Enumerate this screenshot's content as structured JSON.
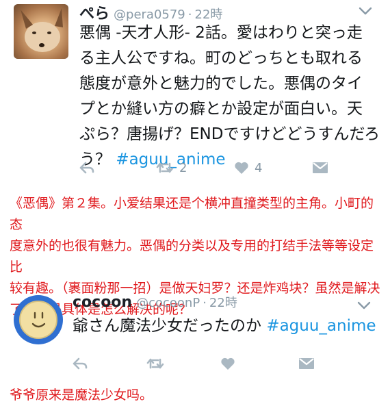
{
  "tweet1": {
    "name": "ぺら",
    "handle": "@pera0579",
    "dot": "·",
    "time": "22時",
    "lines": [
      "悪偶 -天才人形- 2話。愛はわりと突っ走",
      "る主人公ですね。町のどっちとも取れる",
      "態度が意外と魅力的でした。悪偶のタイ",
      "プとか縫い方の癖とか設定が面白い。天",
      "ぷら？唐揚げ？ENDですけどどうすんだろ",
      "う？"
    ],
    "hashtag": "#aguu_anime",
    "retweets": "2",
    "likes": "4"
  },
  "translation1": {
    "lines": [
      "《恶偶》第２集。小爱结果还是个横冲直撞类型的主角。小町的态",
      "度意外的也很有魅力。恶偶的分类以及专用的打结手法等等设定比",
      "较有趣。（裹面粉那一招）是做天妇罗？还是炸鸡块？虽然是解决",
      "了他但是具体是怎么解决的呢？"
    ]
  },
  "tweet2": {
    "name": "cocoon",
    "handle": "@cocoonP",
    "dot": "·",
    "time": "22時",
    "text": "爺さん魔法少女だったのか",
    "hashtag": "#aguu_anime"
  },
  "translation2": {
    "text": "爷爷原来是魔法少女吗。"
  },
  "icons": {
    "reply": "reply-icon",
    "retweet": "retweet-icon",
    "like": "heart-icon",
    "dm": "direct-message-icon",
    "more": "chevron-down-icon"
  },
  "colors": {
    "hashtag": "#1b95e0",
    "meta": "#8899a6",
    "translation": "#e0191d",
    "action_icon": "#aab8c2"
  }
}
